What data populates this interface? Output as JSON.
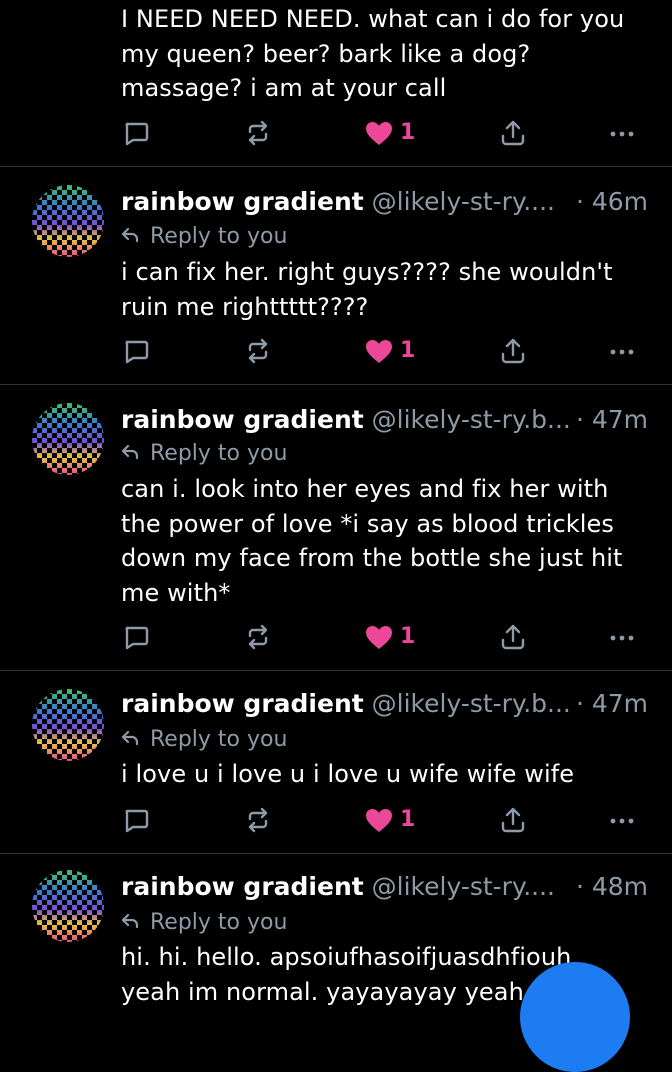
{
  "top_post": {
    "text": "I NEED NEED NEED. what can i do for you my queen? beer? bark like a dog? massage? i am at your call",
    "like_count": "1"
  },
  "reply_posts": [
    {
      "display_name": "rainbow gradient",
      "handle": "@likely-st-ry....",
      "time": "· 46m",
      "reply_label": "Reply to you",
      "text": "i can fix her. right guys???? she wouldn't ruin me righttttt????",
      "like_count": "1"
    },
    {
      "display_name": "rainbow gradient",
      "handle": "@likely-st-ry.b...",
      "time": "· 47m",
      "reply_label": "Reply to you",
      "text": "can i. look into her eyes and fix her with the power of love *i say as blood trickles down my face from the bottle she just hit me with*",
      "like_count": "1"
    },
    {
      "display_name": "rainbow gradient",
      "handle": "@likely-st-ry.b...",
      "time": "· 47m",
      "reply_label": "Reply to you",
      "text": "i love u i love u i love u wife wife wife",
      "like_count": "1"
    },
    {
      "display_name": "rainbow gradient",
      "handle": "@likely-st-ry....",
      "time": "· 48m",
      "reply_label": "Reply to you",
      "text": "hi. hi. hello. apsoiufhasoifjuasdhfiouh yeah im normal. yayayayay yeah",
      "like_count": ""
    }
  ],
  "colors": {
    "background": "#000000",
    "divider": "#2c3641",
    "muted_text": "#8d9aa8",
    "like_pink": "#ec4899",
    "fab_blue": "#1d7cf2"
  },
  "icons": {
    "reply": "speech-bubble-icon",
    "repost": "repost-arrows-icon",
    "like": "heart-icon",
    "share": "share-upload-icon",
    "more": "ellipsis-icon",
    "reply_indicator": "reply-arrow-icon"
  }
}
